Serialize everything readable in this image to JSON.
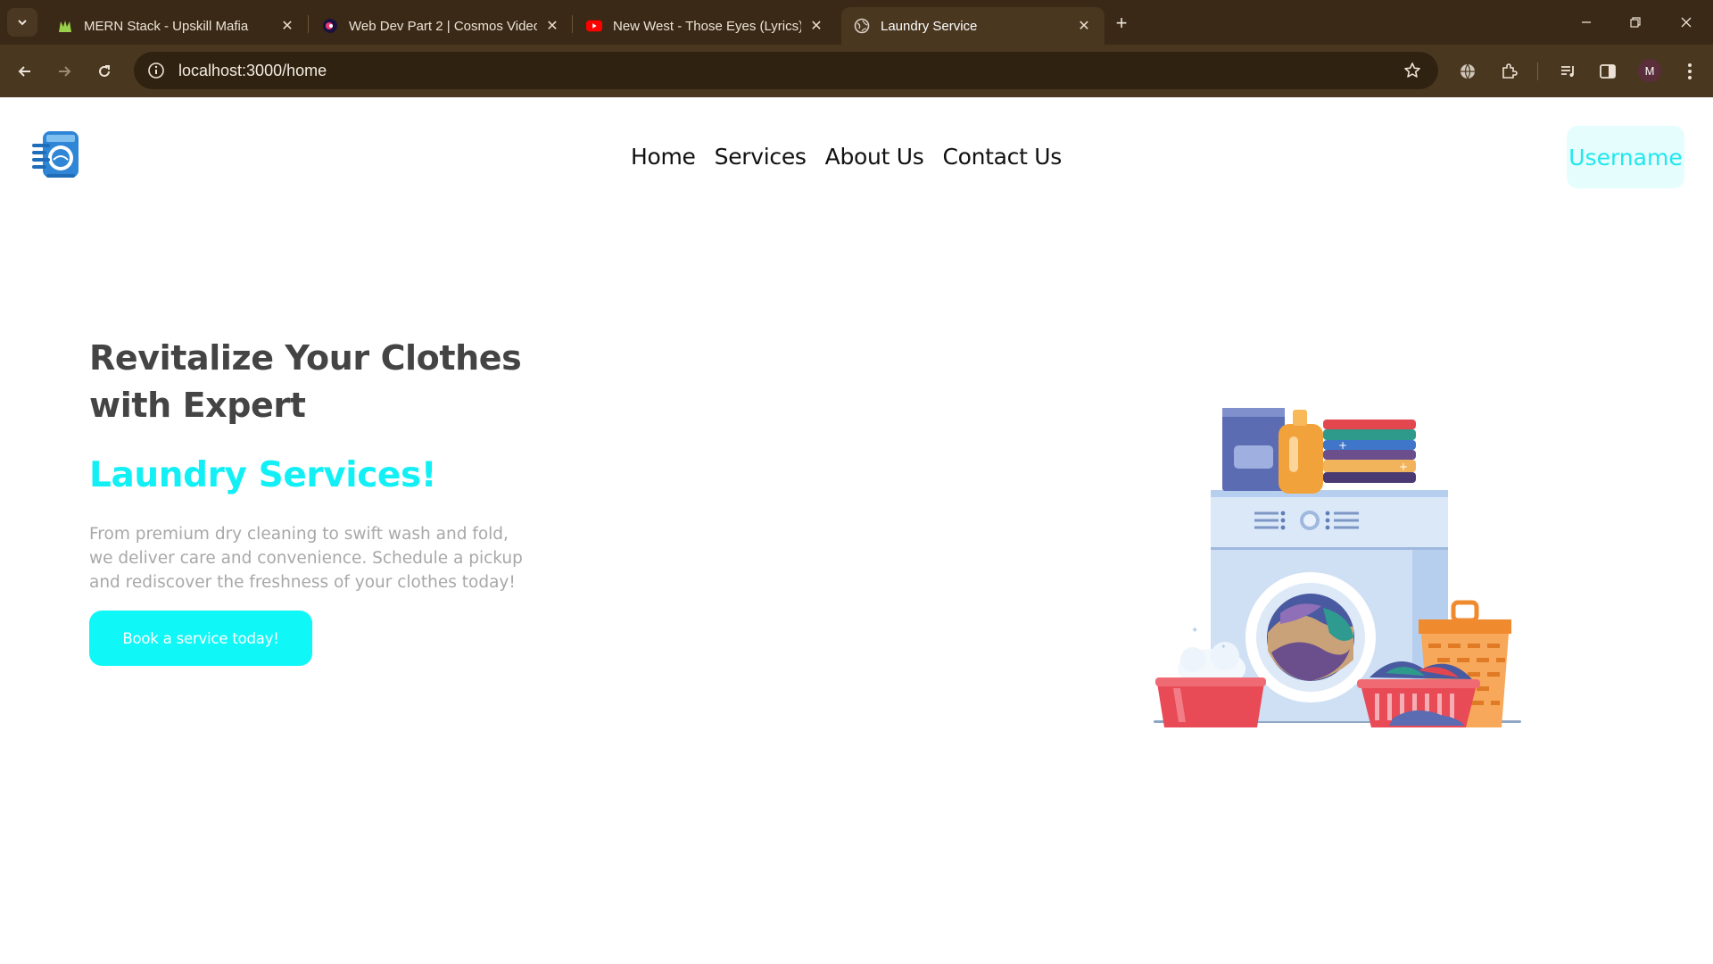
{
  "browser": {
    "tabs": [
      {
        "title": "MERN Stack - Upskill Mafia",
        "favicon": "mafia-icon"
      },
      {
        "title": "Web Dev Part 2 | Cosmos Video",
        "favicon": "cosmos-icon"
      },
      {
        "title": "New West - Those Eyes (Lyrics)",
        "favicon": "youtube-icon"
      },
      {
        "title": "Laundry Service",
        "favicon": "globe-icon",
        "active": true
      }
    ],
    "url": "localhost:3000/home",
    "profile_initial": "M"
  },
  "site": {
    "nav": [
      "Home",
      "Services",
      "About Us",
      "Contact Us"
    ],
    "user_button": "Username",
    "colors": {
      "accent": "#12f0f6",
      "heading": "#444444",
      "body_text": "#a8a8a8"
    }
  },
  "hero": {
    "title": "Revitalize Your Clothes with Expert",
    "accent": "Laundry Services!",
    "description": "From premium dry cleaning to swift wash and fold, we deliver care and convenience. Schedule a pickup and rediscover the freshness of your clothes today!",
    "cta": "Book a service today!"
  }
}
